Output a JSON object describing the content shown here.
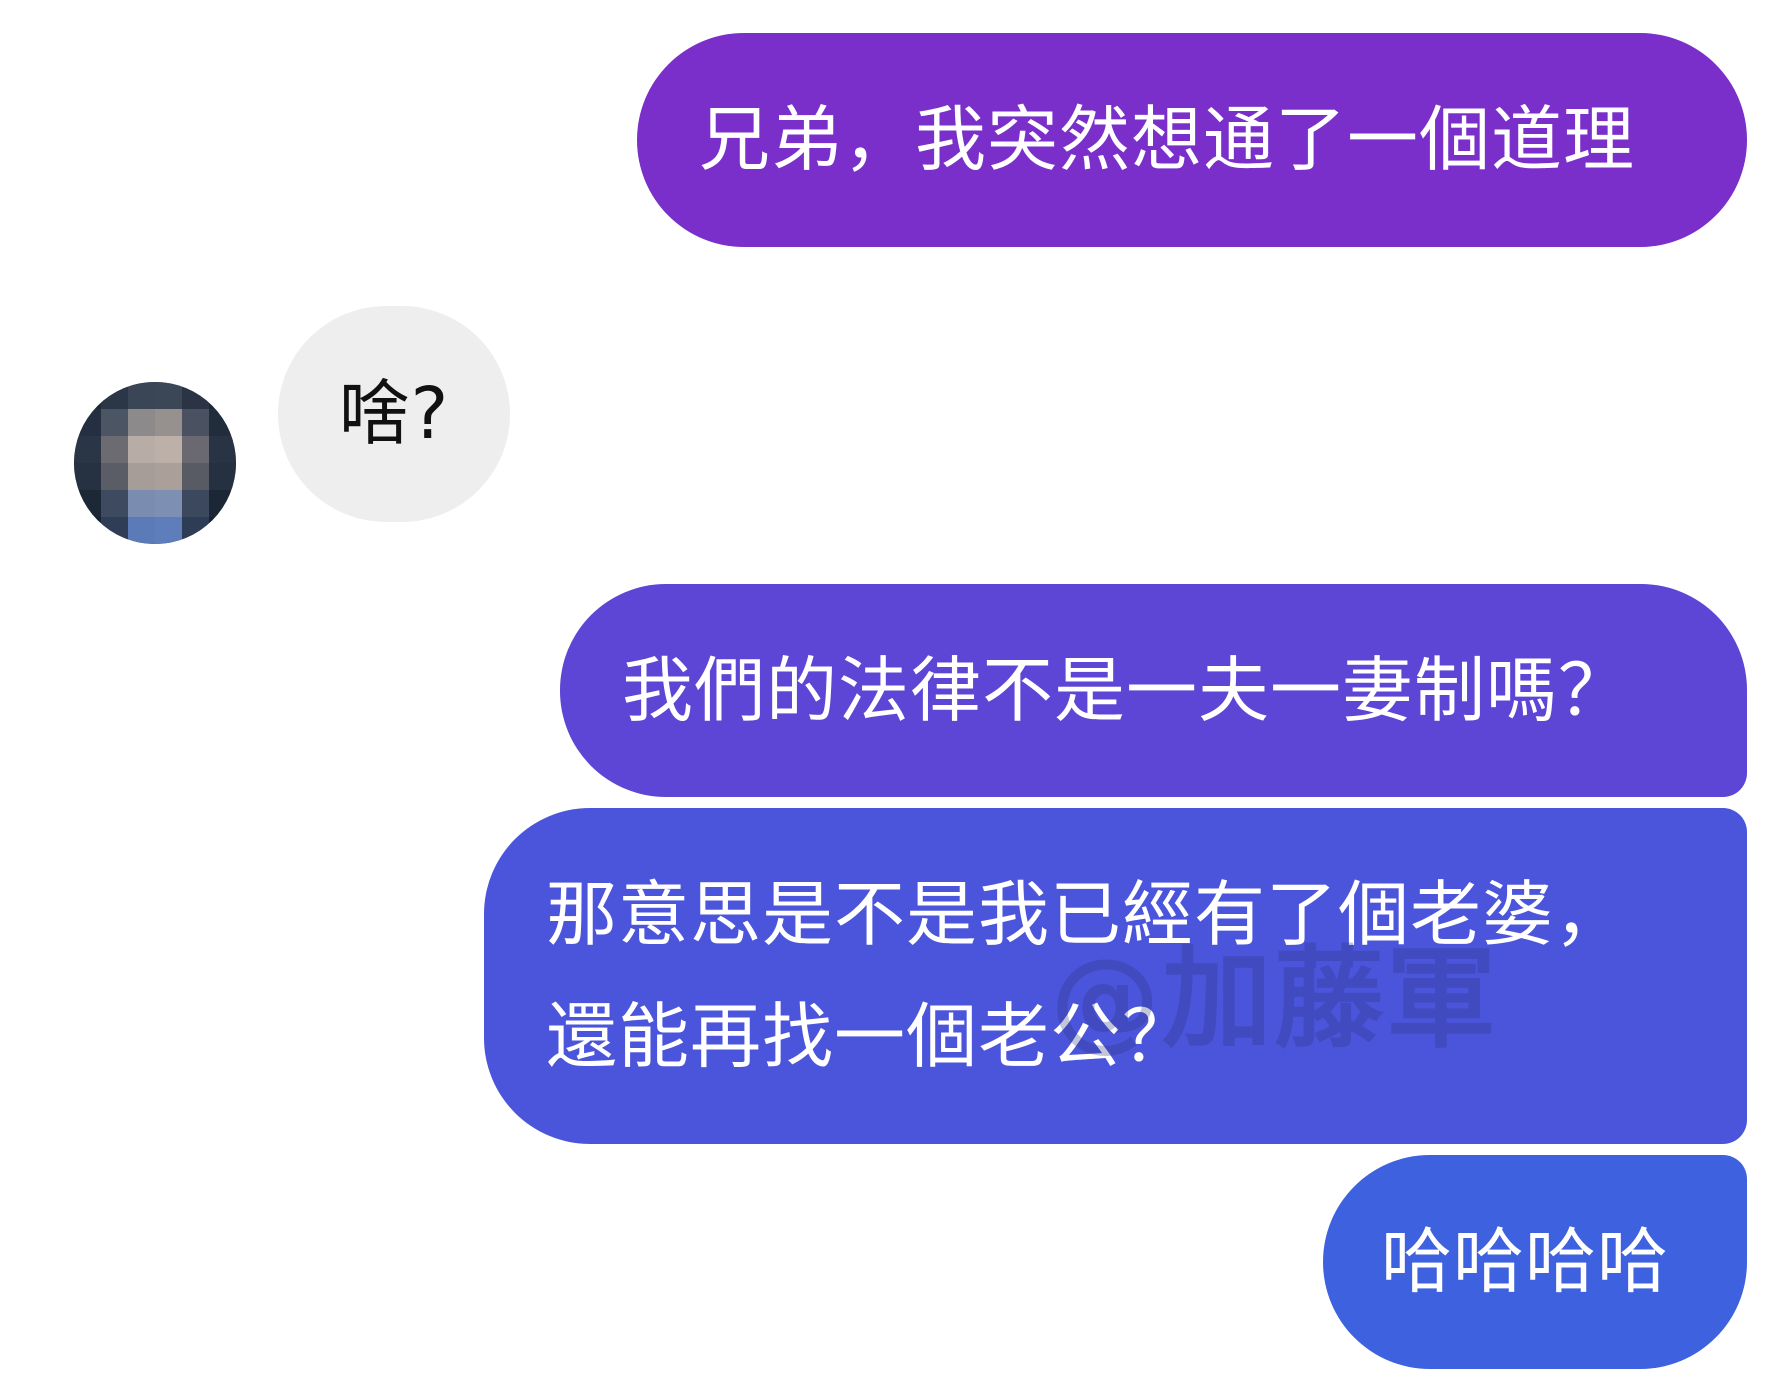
{
  "conversation": {
    "messages": [
      {
        "direction": "outgoing",
        "text": "兄弟，我突然想通了一個道理",
        "color": "#7a2fca"
      },
      {
        "direction": "incoming",
        "text": "啥?",
        "color": "#eeeeef"
      },
      {
        "direction": "outgoing",
        "text": "我們的法律不是一夫一妻制嗎？",
        "color": "#5d45d6"
      },
      {
        "direction": "outgoing",
        "lines": [
          "那意思是不是我已經有了個老婆，",
          "還能再找一個老公？"
        ],
        "color": "#4b55db"
      },
      {
        "direction": "outgoing",
        "text": "哈哈哈哈",
        "color": "#3e62df"
      }
    ]
  },
  "contact": {
    "avatar_icon": "avatar-pixelated"
  },
  "watermark": {
    "text": "@加藤軍"
  }
}
